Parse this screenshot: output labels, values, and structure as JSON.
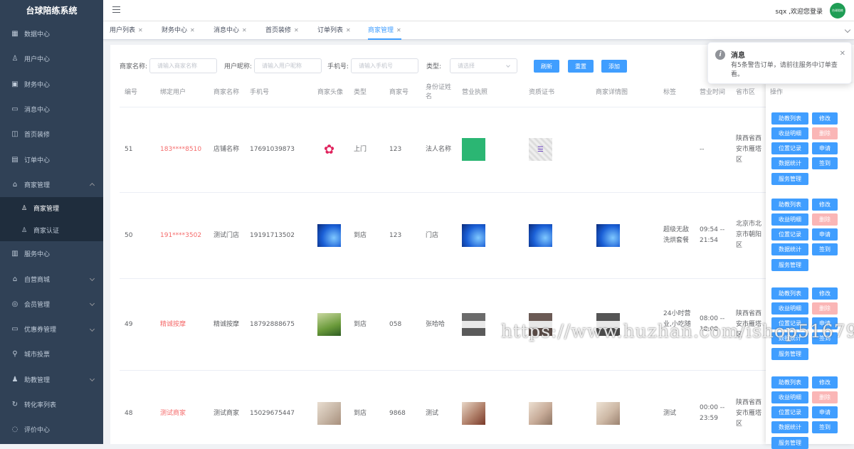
{
  "app": {
    "title": "台球陪练系统"
  },
  "sidebar": {
    "items": [
      {
        "label": "数据中心",
        "icon": "chart-icon"
      },
      {
        "label": "用户中心",
        "icon": "user-icon"
      },
      {
        "label": "财务中心",
        "icon": "wallet-icon"
      },
      {
        "label": "消息中心",
        "icon": "message-icon"
      },
      {
        "label": "首页装修",
        "icon": "box-icon"
      },
      {
        "label": "订单中心",
        "icon": "cart-icon"
      },
      {
        "label": "商家管理",
        "icon": "home-icon"
      }
    ],
    "submenu": [
      {
        "label": "商家管理"
      },
      {
        "label": "商家认证"
      }
    ],
    "items_after": [
      {
        "label": "服务中心",
        "icon": "clipboard-icon"
      },
      {
        "label": "自营商城",
        "icon": "store-icon"
      },
      {
        "label": "会员管理",
        "icon": "member-icon"
      },
      {
        "label": "优惠券管理",
        "icon": "coupon-icon"
      },
      {
        "label": "城市投票",
        "icon": "vote-icon"
      },
      {
        "label": "助教管理",
        "icon": "assistant-icon"
      },
      {
        "label": "转化率列表",
        "icon": "refresh-icon"
      },
      {
        "label": "评价中心",
        "icon": "comment-icon"
      }
    ]
  },
  "topbar": {
    "welcome": "sqx ,欢迎您登录",
    "avatar_text": "台球陪练"
  },
  "tabs": [
    "用户列表",
    "财务中心",
    "消息中心",
    "首页装修",
    "订单列表",
    "商家管理"
  ],
  "filters": {
    "name_label": "商家名称:",
    "name_placeholder": "请输入商家名称",
    "nick_label": "用户昵称:",
    "nick_placeholder": "请输入用户昵称",
    "phone_label": "手机号:",
    "phone_placeholder": "请输入手机号",
    "type_label": "类型:",
    "type_placeholder": "请选择"
  },
  "buttons": {
    "refresh": "刷新",
    "reset": "重置",
    "add": "添加"
  },
  "table": {
    "headers": {
      "id": "编号",
      "user": "绑定用户",
      "name": "商家名称",
      "phone": "手机号",
      "avatar": "商家头像",
      "type": "类型",
      "no": "商家号",
      "idname": "身份证姓名",
      "license": "营业执照",
      "cert": "资质证书",
      "detail": "商家详情图",
      "tag": "标签",
      "hours": "营业时间",
      "region": "省市区",
      "ops": "操作"
    },
    "rows": [
      {
        "id": "51",
        "user": "183****8510",
        "name": "店铺名称",
        "phone": "17691039873",
        "type": "上门",
        "no": "123",
        "idname": "法人名称",
        "tag": "",
        "hours": "--",
        "region": "陕西省西安市雁塔区"
      },
      {
        "id": "50",
        "user": "191****3502",
        "name": "测试门店",
        "phone": "19191713502",
        "type": "到店",
        "no": "123",
        "idname": "门店",
        "tag": "超级无敌洗烘套餐",
        "hours": "09:54 -- 21:54",
        "region": "北京市北京市朝阳区"
      },
      {
        "id": "49",
        "user": "精诚按摩",
        "name": "精诚按摩",
        "phone": "18792888675",
        "type": "到店",
        "no": "058",
        "idname": "张哈哈",
        "tag": "24小时营业,小吃随",
        "hours": "08:00 -- 18:00",
        "region": "陕西省西安市雁塔区"
      },
      {
        "id": "48",
        "user": "测试商家",
        "name": "测试商家",
        "phone": "15029675447",
        "type": "到店",
        "no": "9868",
        "idname": "测试",
        "tag": "测试",
        "hours": "00:00 -- 23:59",
        "region": "陕西省西安市雁塔区"
      }
    ],
    "ops": {
      "teach": "助教列表",
      "edit": "修改",
      "income": "收益明细",
      "del": "删除",
      "location": "位置记录",
      "apply": "申请",
      "stats": "数据统计",
      "sign": "签到",
      "service": "服务管理"
    }
  },
  "notice": {
    "title": "消息",
    "body": "有5条警告订单，请前往服务中订单查看。"
  },
  "watermark": "https://www.huzhan.com/ishop51679",
  "colors": {
    "primary": "#409eff",
    "sidebar": "#304156",
    "danger": "#f56c6c"
  }
}
